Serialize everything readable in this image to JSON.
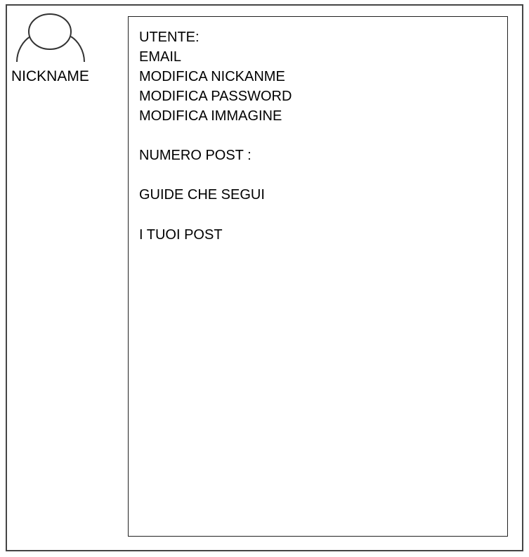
{
  "profile": {
    "nickname": "NICKNAME",
    "avatar_icon": "user-avatar-icon"
  },
  "panel": {
    "utente_label": "UTENTE:",
    "email_label": "EMAIL",
    "edit_nickname": "MODIFICA NICKANME",
    "edit_password": "MODIFICA PASSWORD",
    "edit_image": "MODIFICA IMMAGINE",
    "post_count_label": "NUMERO POST :",
    "followed_guides": "GUIDE CHE SEGUI",
    "your_posts": "I TUOI POST"
  }
}
